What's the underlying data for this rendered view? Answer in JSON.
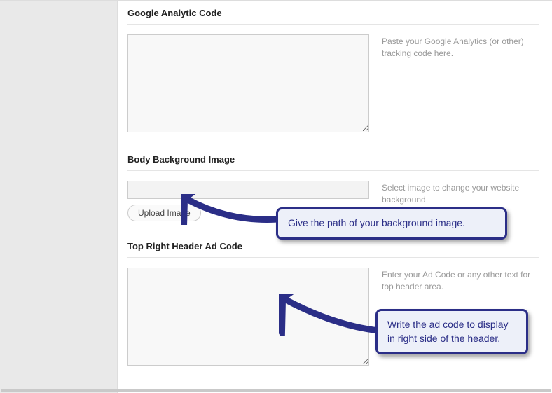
{
  "sections": {
    "analytics": {
      "title": "Google Analytic Code",
      "value": "",
      "help": "Paste your Google Analytics (or other) tracking code here."
    },
    "bodybg": {
      "title": "Body Background Image",
      "path_value": "",
      "upload_label": "Upload Image",
      "help": "Select image to change your website background"
    },
    "adcode": {
      "title": "Top Right Header Ad Code",
      "value": "",
      "help": "Enter your Ad Code or any other text for top header area."
    }
  },
  "callouts": {
    "bg": "Give the path of your background image.",
    "ad": "Write the ad code to display in right side of the header."
  }
}
